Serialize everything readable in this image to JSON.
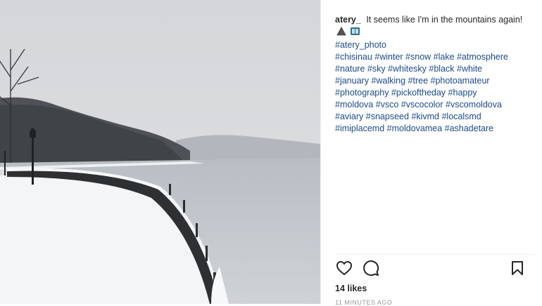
{
  "post": {
    "image_alt": "",
    "caption": {
      "username": "atery_",
      "text": "It seems like I'm in the mountains again!",
      "emoji": [
        "warning-sign-emoji",
        "book-emoji"
      ],
      "hashtag_lines": [
        "#atery_photo",
        "#chisinau #winter #snow #lake #atmosphere",
        "#nature #sky #whitesky #black #white",
        "#january #walking #tree #photoamateur",
        "#photography #pickoftheday #happy",
        "#moldova #vsco #vscocolor #vscomoldova",
        "#aviary #snapseed #kivmd #localsmd",
        "#imiplacemd #moldovamea #ashadetare"
      ]
    },
    "actions": {
      "like_icon": "heart-outline-icon",
      "comment_icon": "comment-bubble-icon",
      "save_icon": "bookmark-outline-icon"
    },
    "likes": "14 likes",
    "timestamp": "11 MINUTES AGO"
  },
  "colors": {
    "hashtag": "#1b4a8a",
    "text": "#262626",
    "muted": "#999999"
  }
}
